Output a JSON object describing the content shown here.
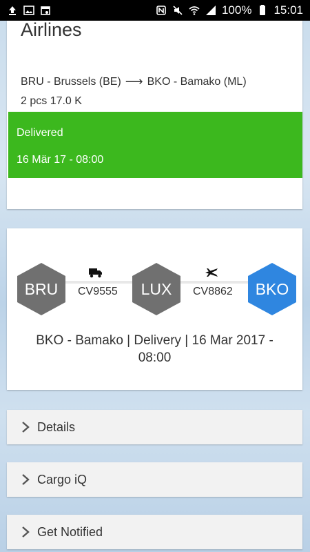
{
  "status_bar": {
    "left_icons": [
      "upload-icon",
      "image-icon",
      "calendar-icon"
    ],
    "right_icons": [
      "nfc-icon",
      "mute-icon",
      "wifi-icon",
      "signal-icon"
    ],
    "battery": "100%",
    "time": "15:01"
  },
  "shipment": {
    "airline_title": "Airlines",
    "origin": "BRU - Brussels (BE)",
    "destination": "BKO - Bamako (ML)",
    "pieces_weight": "2 pcs 17.0 K",
    "status": "Delivered",
    "status_date": "16 Mär 17 - 08:00",
    "status_color": "#3cb81e"
  },
  "route": {
    "stops": [
      {
        "code": "BRU",
        "color": "#707070"
      },
      {
        "code": "LUX",
        "color": "#707070"
      },
      {
        "code": "BKO",
        "color": "#2f86e0"
      }
    ],
    "legs": [
      {
        "flight": "CV9555",
        "icon": "truck-icon"
      },
      {
        "flight": "CV8862",
        "icon": "airplane-icon"
      }
    ],
    "delivery_text": "BKO - Bamako | Delivery | 16 Mar 2017 - 08:00"
  },
  "sections": [
    {
      "label": "Details"
    },
    {
      "label": "Cargo iQ"
    },
    {
      "label": "Get Notified"
    }
  ]
}
